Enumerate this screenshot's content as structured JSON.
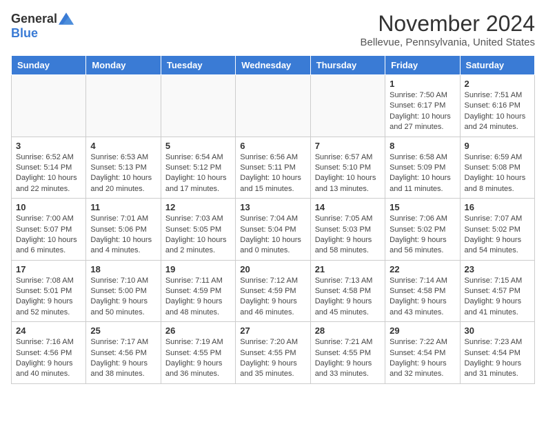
{
  "logo": {
    "general": "General",
    "blue": "Blue"
  },
  "header": {
    "title": "November 2024",
    "location": "Bellevue, Pennsylvania, United States"
  },
  "weekdays": [
    "Sunday",
    "Monday",
    "Tuesday",
    "Wednesday",
    "Thursday",
    "Friday",
    "Saturday"
  ],
  "weeks": [
    [
      {
        "day": "",
        "info": ""
      },
      {
        "day": "",
        "info": ""
      },
      {
        "day": "",
        "info": ""
      },
      {
        "day": "",
        "info": ""
      },
      {
        "day": "",
        "info": ""
      },
      {
        "day": "1",
        "info": "Sunrise: 7:50 AM\nSunset: 6:17 PM\nDaylight: 10 hours and 27 minutes."
      },
      {
        "day": "2",
        "info": "Sunrise: 7:51 AM\nSunset: 6:16 PM\nDaylight: 10 hours and 24 minutes."
      }
    ],
    [
      {
        "day": "3",
        "info": "Sunrise: 6:52 AM\nSunset: 5:14 PM\nDaylight: 10 hours and 22 minutes."
      },
      {
        "day": "4",
        "info": "Sunrise: 6:53 AM\nSunset: 5:13 PM\nDaylight: 10 hours and 20 minutes."
      },
      {
        "day": "5",
        "info": "Sunrise: 6:54 AM\nSunset: 5:12 PM\nDaylight: 10 hours and 17 minutes."
      },
      {
        "day": "6",
        "info": "Sunrise: 6:56 AM\nSunset: 5:11 PM\nDaylight: 10 hours and 15 minutes."
      },
      {
        "day": "7",
        "info": "Sunrise: 6:57 AM\nSunset: 5:10 PM\nDaylight: 10 hours and 13 minutes."
      },
      {
        "day": "8",
        "info": "Sunrise: 6:58 AM\nSunset: 5:09 PM\nDaylight: 10 hours and 11 minutes."
      },
      {
        "day": "9",
        "info": "Sunrise: 6:59 AM\nSunset: 5:08 PM\nDaylight: 10 hours and 8 minutes."
      }
    ],
    [
      {
        "day": "10",
        "info": "Sunrise: 7:00 AM\nSunset: 5:07 PM\nDaylight: 10 hours and 6 minutes."
      },
      {
        "day": "11",
        "info": "Sunrise: 7:01 AM\nSunset: 5:06 PM\nDaylight: 10 hours and 4 minutes."
      },
      {
        "day": "12",
        "info": "Sunrise: 7:03 AM\nSunset: 5:05 PM\nDaylight: 10 hours and 2 minutes."
      },
      {
        "day": "13",
        "info": "Sunrise: 7:04 AM\nSunset: 5:04 PM\nDaylight: 10 hours and 0 minutes."
      },
      {
        "day": "14",
        "info": "Sunrise: 7:05 AM\nSunset: 5:03 PM\nDaylight: 9 hours and 58 minutes."
      },
      {
        "day": "15",
        "info": "Sunrise: 7:06 AM\nSunset: 5:02 PM\nDaylight: 9 hours and 56 minutes."
      },
      {
        "day": "16",
        "info": "Sunrise: 7:07 AM\nSunset: 5:02 PM\nDaylight: 9 hours and 54 minutes."
      }
    ],
    [
      {
        "day": "17",
        "info": "Sunrise: 7:08 AM\nSunset: 5:01 PM\nDaylight: 9 hours and 52 minutes."
      },
      {
        "day": "18",
        "info": "Sunrise: 7:10 AM\nSunset: 5:00 PM\nDaylight: 9 hours and 50 minutes."
      },
      {
        "day": "19",
        "info": "Sunrise: 7:11 AM\nSunset: 4:59 PM\nDaylight: 9 hours and 48 minutes."
      },
      {
        "day": "20",
        "info": "Sunrise: 7:12 AM\nSunset: 4:59 PM\nDaylight: 9 hours and 46 minutes."
      },
      {
        "day": "21",
        "info": "Sunrise: 7:13 AM\nSunset: 4:58 PM\nDaylight: 9 hours and 45 minutes."
      },
      {
        "day": "22",
        "info": "Sunrise: 7:14 AM\nSunset: 4:58 PM\nDaylight: 9 hours and 43 minutes."
      },
      {
        "day": "23",
        "info": "Sunrise: 7:15 AM\nSunset: 4:57 PM\nDaylight: 9 hours and 41 minutes."
      }
    ],
    [
      {
        "day": "24",
        "info": "Sunrise: 7:16 AM\nSunset: 4:56 PM\nDaylight: 9 hours and 40 minutes."
      },
      {
        "day": "25",
        "info": "Sunrise: 7:17 AM\nSunset: 4:56 PM\nDaylight: 9 hours and 38 minutes."
      },
      {
        "day": "26",
        "info": "Sunrise: 7:19 AM\nSunset: 4:55 PM\nDaylight: 9 hours and 36 minutes."
      },
      {
        "day": "27",
        "info": "Sunrise: 7:20 AM\nSunset: 4:55 PM\nDaylight: 9 hours and 35 minutes."
      },
      {
        "day": "28",
        "info": "Sunrise: 7:21 AM\nSunset: 4:55 PM\nDaylight: 9 hours and 33 minutes."
      },
      {
        "day": "29",
        "info": "Sunrise: 7:22 AM\nSunset: 4:54 PM\nDaylight: 9 hours and 32 minutes."
      },
      {
        "day": "30",
        "info": "Sunrise: 7:23 AM\nSunset: 4:54 PM\nDaylight: 9 hours and 31 minutes."
      }
    ]
  ]
}
